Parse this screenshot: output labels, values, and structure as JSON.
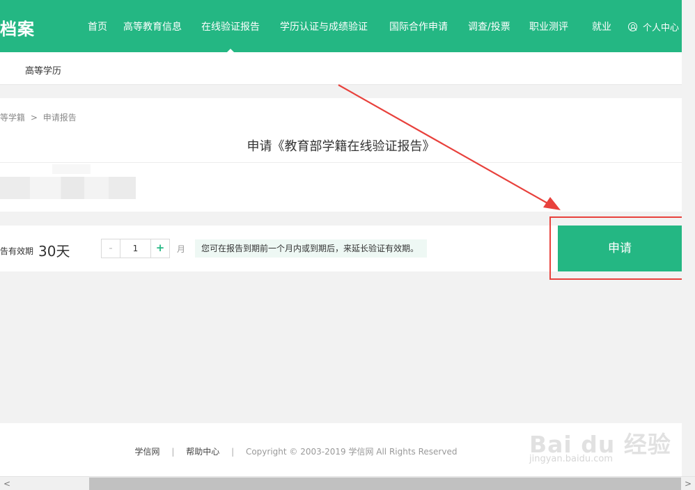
{
  "header": {
    "logo": "档案",
    "nav": [
      "首页",
      "高等教育信息",
      "在线验证报告",
      "学历认证与成绩验证",
      "国际合作申请",
      "调查/投票",
      "职业测评",
      "就业"
    ],
    "active_index": 2,
    "user_center": "个人中心",
    "user_icon": "user-circle-icon",
    "color": "#24b783"
  },
  "subnav": {
    "item": "高等学历"
  },
  "breadcrumb": {
    "parent": "等学籍",
    "sep": ">",
    "current": "申请报告"
  },
  "card": {
    "title": "申请《教育部学籍在线验证报告》"
  },
  "validity": {
    "label": "告有效期",
    "days": "30天",
    "minus": "-",
    "value": "1",
    "plus": "+",
    "unit": "月",
    "tip": "您可在报告到期前一个月内或到期后，来延长验证有效期。"
  },
  "apply_button": "申请",
  "annotation": {
    "arrow_color": "#e8413c",
    "box_color": "#e8413c"
  },
  "footer": {
    "link1": "学信网",
    "sep": "|",
    "link2": "帮助中心",
    "copyright": "Copyright © 2003-2019 学信网 All Rights Reserved"
  },
  "watermark": {
    "big": "Bai du 经验",
    "small": "jingyan.baidu.com"
  },
  "scrollbar": {
    "left": "<",
    "right": ">"
  }
}
